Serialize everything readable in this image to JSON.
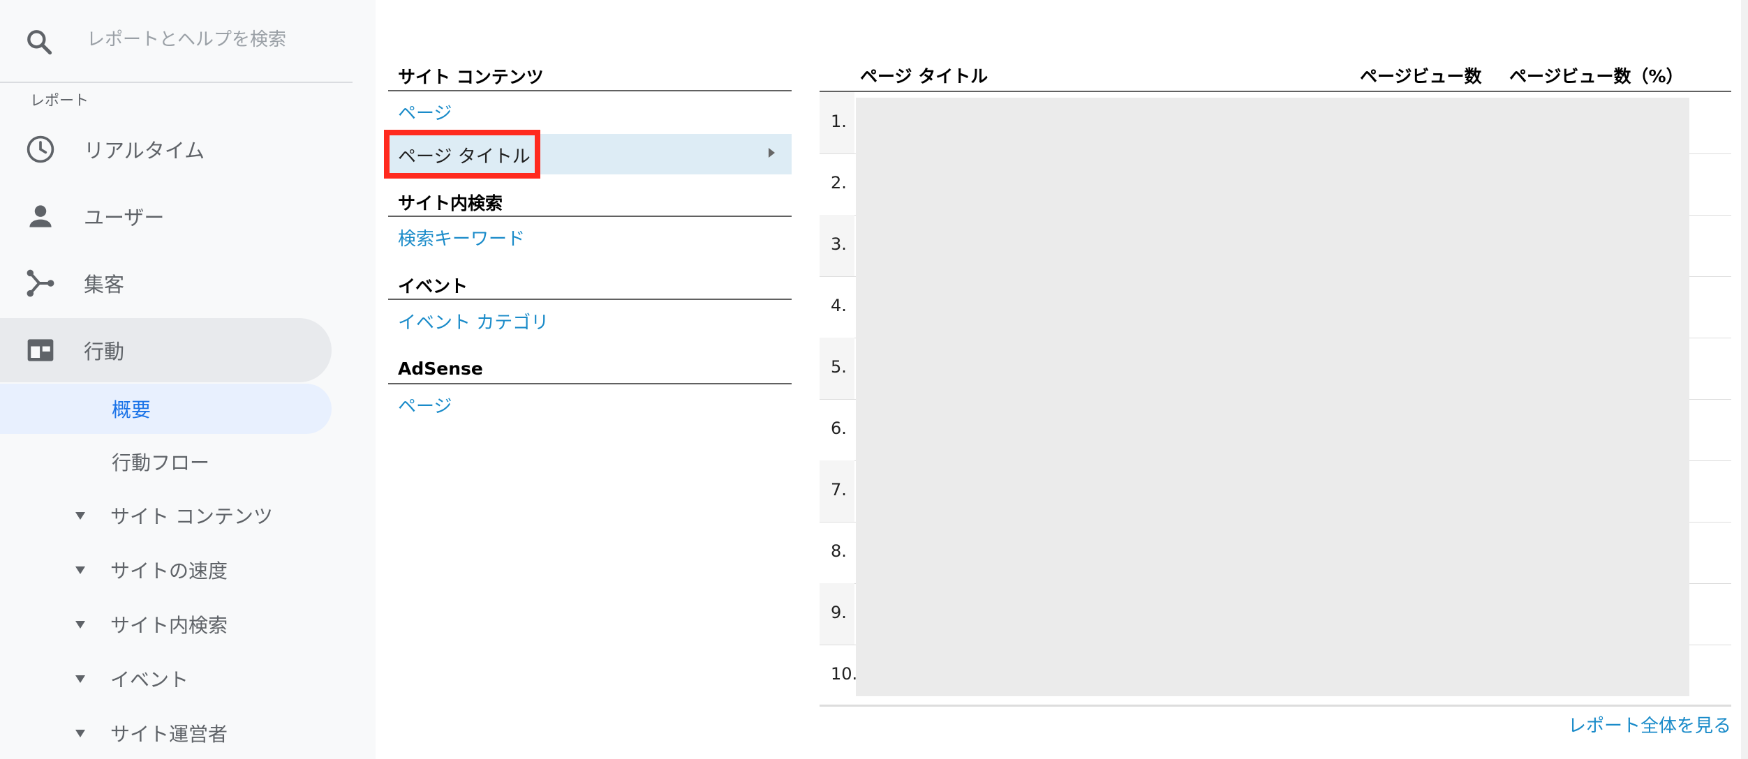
{
  "sidebar": {
    "search_placeholder": "レポートとヘルプを検索",
    "section_label": "レポート",
    "nav": [
      {
        "label": "リアルタイム",
        "icon": "clock-icon"
      },
      {
        "label": "ユーザー",
        "icon": "person-icon"
      },
      {
        "label": "集客",
        "icon": "acquisition-icon"
      },
      {
        "label": "行動",
        "icon": "behavior-icon"
      }
    ],
    "sub": [
      {
        "label": "概要"
      },
      {
        "label": "行動フロー"
      }
    ],
    "expandable": [
      {
        "label": "サイト コンテンツ"
      },
      {
        "label": "サイトの速度"
      },
      {
        "label": "サイト内検索"
      },
      {
        "label": "イベント"
      },
      {
        "label": "サイト運営者"
      }
    ]
  },
  "menu": {
    "groups": [
      {
        "title": "サイト コンテンツ",
        "links": [
          "ページ",
          "ページ タイトル"
        ]
      },
      {
        "title": "サイト内検索",
        "links": [
          "検索キーワード"
        ]
      },
      {
        "title": "イベント",
        "links": [
          "イベント カテゴリ"
        ]
      },
      {
        "title": "AdSense",
        "links": [
          "ページ"
        ]
      }
    ]
  },
  "table": {
    "headers": [
      "ページ タイトル",
      "ページビュー数",
      "ページビュー数（%）"
    ],
    "rows": [
      "1.",
      "2.",
      "3.",
      "4.",
      "5.",
      "6.",
      "7.",
      "8.",
      "9.",
      "10."
    ],
    "footer_link": "レポート全体を見る"
  },
  "colors": {
    "accent": "#1a73e8",
    "link": "#1a8bc9",
    "highlight": "#ff2a1f",
    "selected_row": "#ddecf5"
  }
}
